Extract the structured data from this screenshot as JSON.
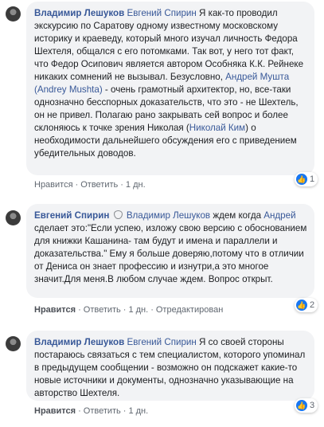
{
  "comments": [
    {
      "author": "Владимир Лешуков",
      "mention": "Евгений Спирин",
      "text_1": " Я как-то проводил экскурсию по Саратову одному известному московскому историку и краеведу, который много изучал личность Федора Шехтеля, общался с его потомками. Так вот, у него тот факт, что Федор Осипович является автором Особняка К.К. Рейнеке никаких сомнений не вызывал. Безусловно, ",
      "mention_2": "Андрей Мушта (Andrey Mushta)",
      "text_2": " - очень грамотный архитектор, но, все-таки однозначно бесспорных доказательств, что это - не Шехтель, он не привел. Полагаю рано закрывать сей вопрос и более склоняюсь к точке зрения Николая (",
      "mention_3": "Николай Ким",
      "text_3": ") о необходимости дальнейшего обсуждения его с приведением убедительных доводов.",
      "actions": {
        "like": "Нравится",
        "reply": "Ответить",
        "time": "1 дн."
      },
      "reaction_count": "1"
    },
    {
      "author": "Евгений Спирин",
      "mention": "Владимир Лешуков",
      "text_1": " ждем когда ",
      "mention_2": "Андрей",
      "text_2": " сделает это:\"Если успею, изложу свою версию с обоснованием для книжки Кашанина- там будут и имена и параллели и доказательства.\" Ему я больше доверяю,потому что в отличии от Дениса он знает профессию и изнутри,а это многое значит.Для меня.В любом случае ждем. Вопрос открыт.",
      "actions": {
        "like": "Нравится",
        "reply": "Ответить",
        "time": "1 дн.",
        "edited": "Отредактирован"
      },
      "reaction_count": "2"
    },
    {
      "author": "Владимир Лешуков",
      "mention": "Евгений Спирин",
      "text_1": " Я со своей стороны постараюсь связаться с тем специалистом, которого упоминал в предыдущем сообщении - возможно он подскажет какие-то новые источники и документы, однозначно указывающие на авторство Шехтеля.",
      "actions": {
        "like": "Нравится",
        "reply": "Ответить",
        "time": "1 дн."
      },
      "reaction_count": "3"
    }
  ],
  "icons": {
    "like": "thumbs-up-icon",
    "verified": "shield-icon"
  },
  "colors": {
    "link": "#385898",
    "bubble": "#f2f3f5",
    "like_blue": "#1877f2"
  }
}
